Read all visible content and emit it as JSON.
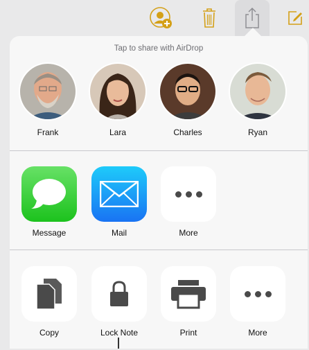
{
  "toolbar": {
    "icons": [
      "add-person-icon",
      "trash-icon",
      "share-icon",
      "compose-icon"
    ],
    "accent": "#d4a017"
  },
  "airdrop": {
    "title": "Tap to share with AirDrop",
    "people": [
      {
        "name": "Frank"
      },
      {
        "name": "Lara"
      },
      {
        "name": "Charles"
      },
      {
        "name": "Ryan"
      }
    ]
  },
  "share_apps": [
    {
      "label": "Message",
      "icon": "message-icon",
      "color": "#1cc21d"
    },
    {
      "label": "Mail",
      "icon": "mail-icon",
      "color": "#1973f3"
    },
    {
      "label": "More",
      "icon": "more-icon"
    }
  ],
  "actions": [
    {
      "label": "Copy",
      "icon": "copy-icon"
    },
    {
      "label": "Lock Note",
      "icon": "lock-icon"
    },
    {
      "label": "Print",
      "icon": "print-icon"
    },
    {
      "label": "More",
      "icon": "more-icon"
    }
  ]
}
